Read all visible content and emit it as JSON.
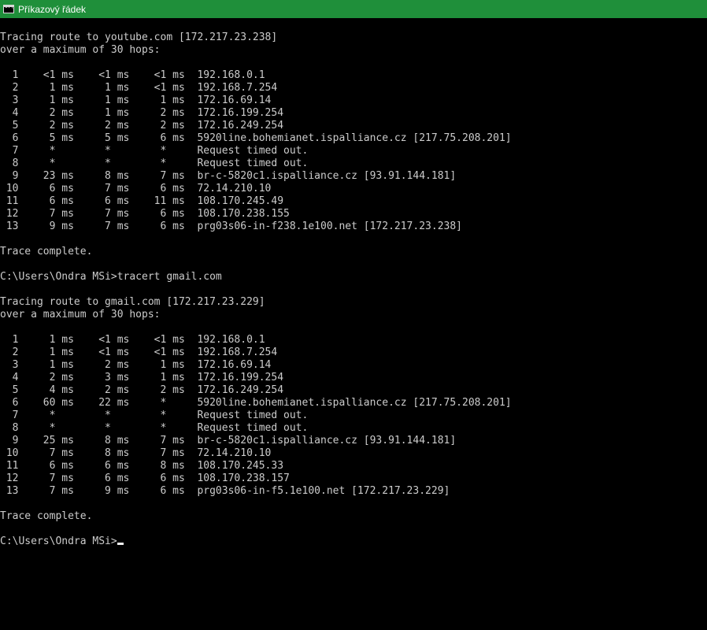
{
  "window": {
    "title": "Příkazový řádek",
    "icon": "cmd-icon",
    "colors": {
      "titlebar": "#1f8f3a",
      "background": "#000000",
      "text": "#cccccc"
    }
  },
  "console": {
    "lines": [
      "Tracing route to youtube.com [172.217.23.238]",
      "over a maximum of 30 hops:",
      "",
      "  1    <1 ms    <1 ms    <1 ms  192.168.0.1",
      "  2     1 ms     1 ms    <1 ms  192.168.7.254",
      "  3     1 ms     1 ms     1 ms  172.16.69.14",
      "  4     2 ms     1 ms     2 ms  172.16.199.254",
      "  5     2 ms     2 ms     2 ms  172.16.249.254",
      "  6     5 ms     5 ms     6 ms  5920line.bohemianet.ispalliance.cz [217.75.208.201]",
      "  7     *        *        *     Request timed out.",
      "  8     *        *        *     Request timed out.",
      "  9    23 ms     8 ms     7 ms  br-c-5820c1.ispalliance.cz [93.91.144.181]",
      " 10     6 ms     7 ms     6 ms  72.14.210.10",
      " 11     6 ms     6 ms    11 ms  108.170.245.49",
      " 12     7 ms     7 ms     6 ms  108.170.238.155",
      " 13     9 ms     7 ms     6 ms  prg03s06-in-f238.1e100.net [172.217.23.238]",
      "",
      "Trace complete.",
      "",
      "C:\\Users\\Ondra MSi>tracert gmail.com",
      "",
      "Tracing route to gmail.com [172.217.23.229]",
      "over a maximum of 30 hops:",
      "",
      "  1     1 ms    <1 ms    <1 ms  192.168.0.1",
      "  2     1 ms    <1 ms    <1 ms  192.168.7.254",
      "  3     1 ms     2 ms     1 ms  172.16.69.14",
      "  4     2 ms     3 ms     1 ms  172.16.199.254",
      "  5     4 ms     2 ms     2 ms  172.16.249.254",
      "  6    60 ms    22 ms     *     5920line.bohemianet.ispalliance.cz [217.75.208.201]",
      "  7     *        *        *     Request timed out.",
      "  8     *        *        *     Request timed out.",
      "  9    25 ms     8 ms     7 ms  br-c-5820c1.ispalliance.cz [93.91.144.181]",
      " 10     7 ms     8 ms     7 ms  72.14.210.10",
      " 11     6 ms     6 ms     8 ms  108.170.245.33",
      " 12     7 ms     6 ms     6 ms  108.170.238.157",
      " 13     7 ms     9 ms     6 ms  prg03s06-in-f5.1e100.net [172.217.23.229]",
      "",
      "Trace complete.",
      ""
    ],
    "prompt": "C:\\Users\\Ondra MSi>"
  }
}
